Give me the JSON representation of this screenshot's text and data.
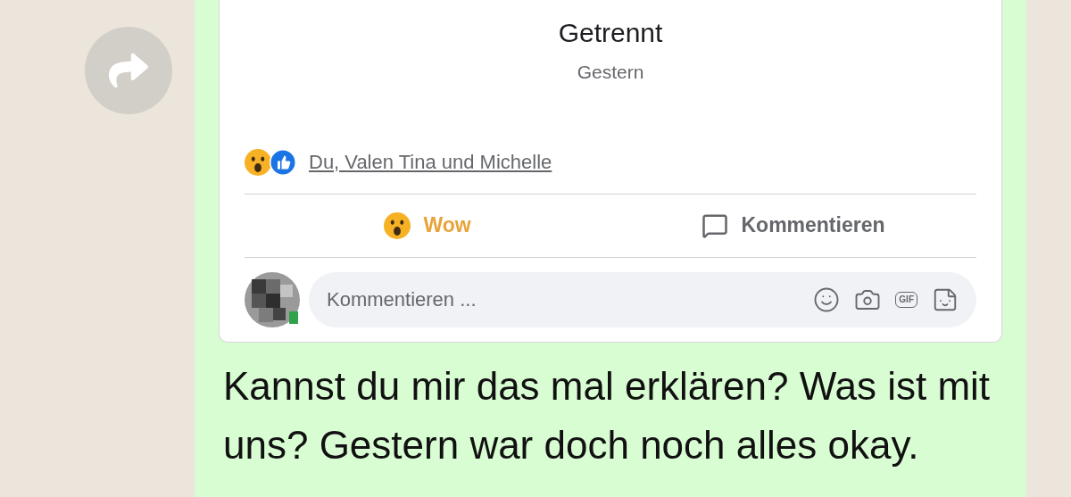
{
  "post": {
    "title": "Getrennt",
    "date": "Gestern",
    "reactions_text": "Du, Valen Tina und Michelle",
    "actions": [
      {
        "kind": "reaction",
        "label": "Wow",
        "selected": true
      },
      {
        "kind": "comment",
        "label": "Kommentieren",
        "selected": false
      }
    ],
    "comment_field": {
      "placeholder": "Kommentieren ...",
      "gif_label": "GIF"
    }
  },
  "message": {
    "text": "Kannst du mir das mal erklären? Was ist mit uns? Gestern war doch noch alles okay."
  }
}
